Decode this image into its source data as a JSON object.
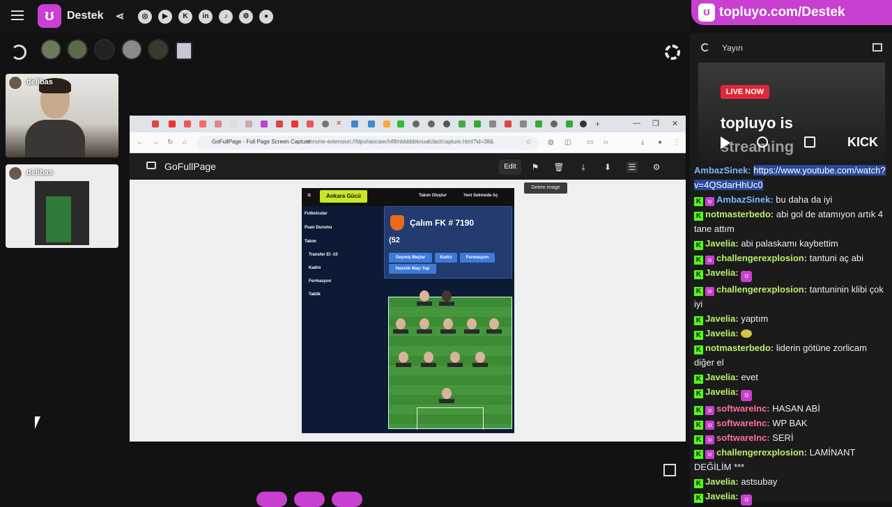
{
  "app": {
    "name": "Destek"
  },
  "promo": {
    "text": "topluyo.com/Destek"
  },
  "social_icons": [
    "instagram-icon",
    "youtube-icon",
    "kick-icon",
    "linkedin-icon",
    "tiktok-icon",
    "steam-icon",
    "github-icon"
  ],
  "webcams": [
    {
      "name": "delibas"
    },
    {
      "name": "delibas"
    }
  ],
  "browser": {
    "tab_title": "GoFullPage - Full Page Screen Capture",
    "url": "chrome-extension://fdpohaocaechififmbbbbbknoalclacl/capture.html?id=38&"
  },
  "gofullpage": {
    "title": "GoFullPage",
    "edit_label": "Edit",
    "tooltip": "Delete image"
  },
  "capture": {
    "brand": "Ankara Gücü",
    "nav": [
      "Takım Oluştur",
      "Yeni Sekmede Aç"
    ],
    "sidebar": [
      "Futbolcular",
      "Puan Durumu",
      "Takım",
      "Transfer Et -10",
      "Kadro",
      "Formasyon",
      "Taktik"
    ],
    "team_title": "Çalım FK # 7190",
    "team_score": "(52",
    "buttons": [
      "Geçmiş Maçlar",
      "Kadro",
      "Formasyon",
      "Hazırlık Maçı Yap"
    ]
  },
  "right_panel": {
    "title": "Yayın",
    "live_label": "LIVE NOW",
    "stream_line1": "topluyo is",
    "stream_line2": "streaming",
    "kick_label": "KICK"
  },
  "chat": [
    {
      "user": "AmbazSinek:",
      "text": "https://www.youtube.com/watch?v=4QSdarHhUc0",
      "link": true,
      "kick": false,
      "badge": false
    },
    {
      "user": "AmbazSinek:",
      "text": "bu daha da iyi",
      "kick": true,
      "badge": true
    },
    {
      "user": "notmasterbedo:",
      "text": "abi gol de atamıyon artık 4 tane attım",
      "kick": true,
      "badge": false
    },
    {
      "user": "Javelia:",
      "text": "abi palaskamı kaybettim",
      "kick": true,
      "badge": false
    },
    {
      "user": "challengerexplosion:",
      "text": "tantuni aç abi",
      "kick": true,
      "badge": true
    },
    {
      "user": "Javelia:",
      "text": "",
      "emote": "topluyo",
      "kick": true,
      "badge": false
    },
    {
      "user": "challengerexplosion:",
      "text": "tantuninin klibi çok iyi",
      "kick": true,
      "badge": true
    },
    {
      "user": "Javelia:",
      "text": "yaptım",
      "kick": true,
      "badge": false
    },
    {
      "user": "Javelia:",
      "text": "",
      "emote": "cat",
      "kick": true,
      "badge": false
    },
    {
      "user": "notmasterbedo:",
      "text": "liderin götüne zorlicam diğer el",
      "kick": true,
      "badge": false
    },
    {
      "user": "Javelia:",
      "text": "evet",
      "kick": true,
      "badge": false
    },
    {
      "user": "Javelia:",
      "text": "",
      "emote": "topluyo",
      "kick": true,
      "badge": false
    },
    {
      "user": "softwareInc:",
      "text": "HASAN ABİ",
      "kick": true,
      "badge": true
    },
    {
      "user": "softwareInc:",
      "text": "WP BAK",
      "kick": true,
      "badge": true
    },
    {
      "user": "softwareInc:",
      "text": "SERİ",
      "kick": true,
      "badge": true
    },
    {
      "user": "challengerexplosion:",
      "text": "LAMİNANT DEĞİLİM ***",
      "kick": true,
      "badge": true
    },
    {
      "user": "Javelia:",
      "text": "astsubay",
      "kick": true,
      "badge": false
    },
    {
      "user": "Javelia:",
      "text": "",
      "emote": "topluyo",
      "kick": true,
      "badge": false
    }
  ],
  "colors": {
    "accent": "#c93fd0",
    "kick_green": "#53fc18",
    "ambaz": "#7ab8ff",
    "challenger": "#b7f06a",
    "javelia": "#b7f06a",
    "software": "#ff6e9a",
    "notmaster": "#b7f06a"
  }
}
